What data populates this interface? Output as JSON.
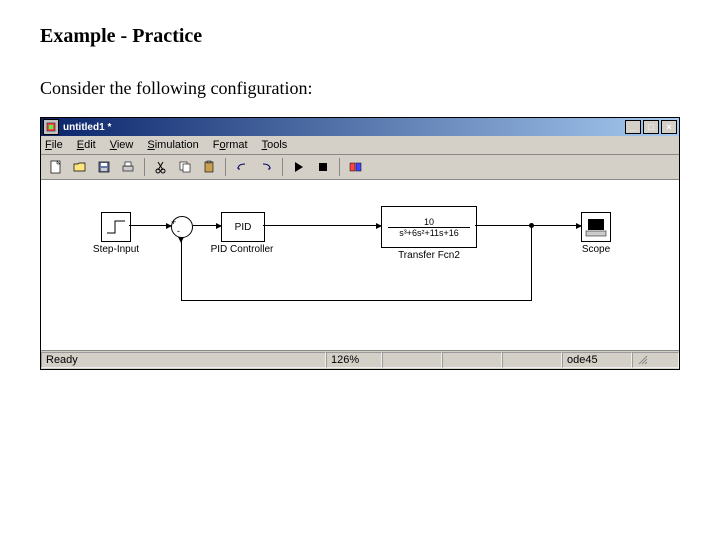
{
  "slide": {
    "title": "Example - Practice",
    "subtitle": "Consider the following configuration:"
  },
  "window": {
    "title": "untitled1 *",
    "menus": {
      "file": "File",
      "edit": "Edit",
      "view": "View",
      "sim": "Simulation",
      "format": "Format",
      "tools": "Tools"
    },
    "status": {
      "ready": "Ready",
      "zoom": "126%",
      "solver": "ode45"
    }
  },
  "blocks": {
    "step": {
      "label": "Step-Input"
    },
    "sum": {
      "plus": "+",
      "minus": "-"
    },
    "pid": {
      "text": "PID",
      "label": "PID Controller"
    },
    "tf": {
      "num": "10",
      "den": "s³+6s²+11s+16",
      "label": "Transfer Fcn2"
    },
    "scope": {
      "label": "Scope"
    }
  }
}
